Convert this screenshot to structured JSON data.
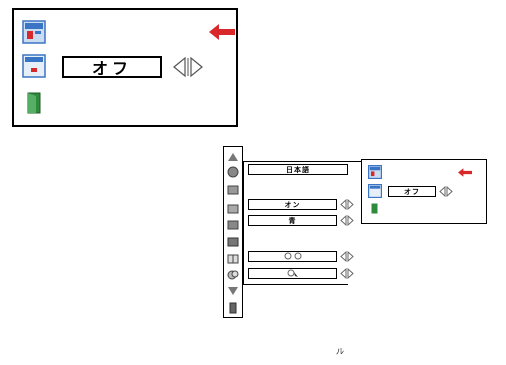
{
  "big_dialog": {
    "value": "オフ"
  },
  "menu": {
    "language": "日本語",
    "row_on": "オン",
    "row_blue": "青",
    "row_bulbs": "",
    "row_lamp": ""
  },
  "mini_dialog": {
    "value": "オフ"
  },
  "footer_mark": "ﾉﾚ",
  "colors": {
    "arrow_red": "#d8282a",
    "icon_blue": "#3a74c4",
    "exit_green": "#2f8a3c"
  }
}
